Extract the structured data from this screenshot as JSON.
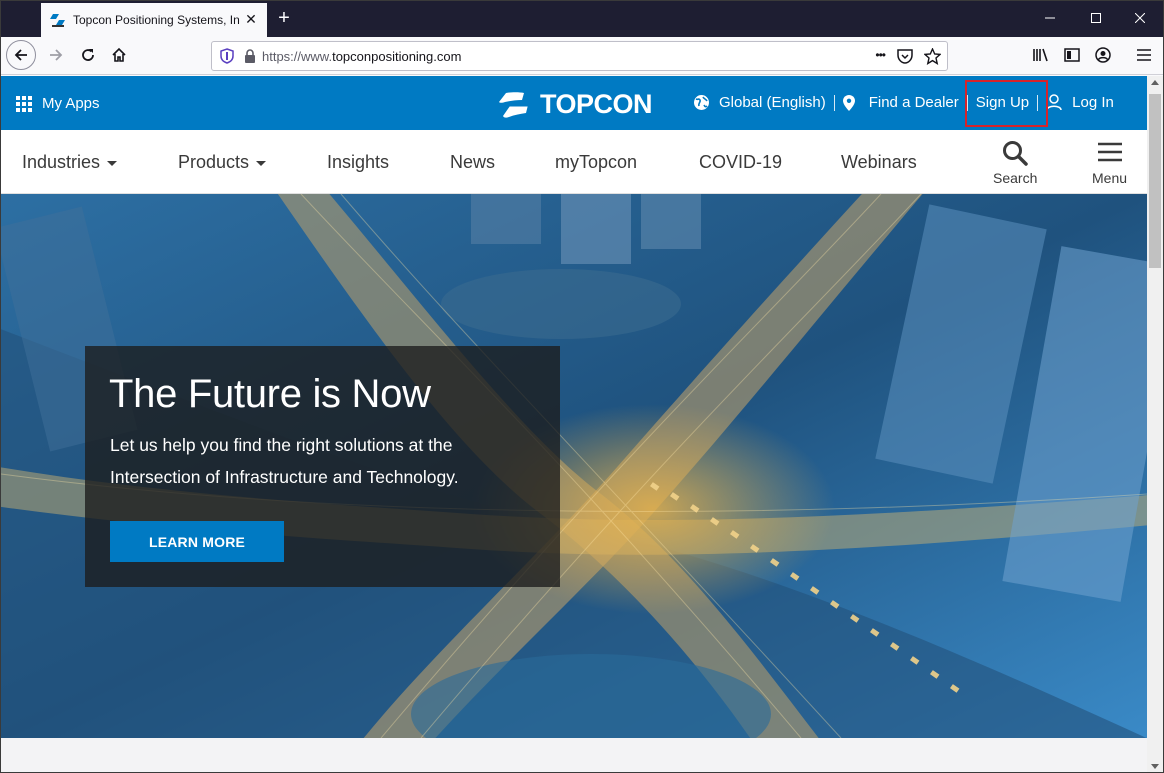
{
  "browser": {
    "tab_title": "Topcon Positioning Systems, In",
    "url_prefix": "https://www.",
    "url_domain": "topconpositioning.com",
    "new_tab_label": "+",
    "more_label": "•••"
  },
  "site": {
    "my_apps": "My Apps",
    "logo_text": "TOPCON",
    "toplinks": {
      "global": "Global (English)",
      "dealer": "Find a Dealer",
      "signup": "Sign Up",
      "login": "Log In"
    },
    "nav": {
      "industries": "Industries",
      "products": "Products",
      "insights": "Insights",
      "news": "News",
      "mytopcon": "myTopcon",
      "covid": "COVID-19",
      "webinars": "Webinars",
      "search": "Search",
      "menu": "Menu"
    },
    "hero": {
      "headline": "The Future is Now",
      "sub_line1": "Let us help you find the right solutions at the",
      "sub_line2": "Intersection of Infrastructure and Technology.",
      "cta": "LEARN MORE"
    }
  },
  "colors": {
    "brand_blue": "#007ac3",
    "highlight_red": "#d8232a",
    "tabstrip": "#1e1e32"
  }
}
